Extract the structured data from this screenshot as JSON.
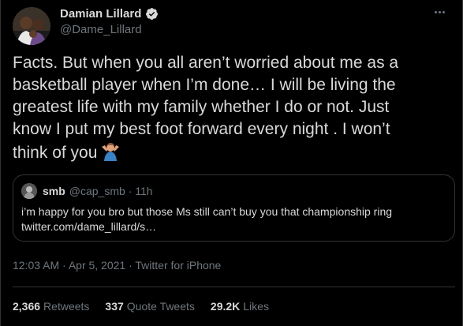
{
  "tweet": {
    "author": {
      "name": "Damian Lillard",
      "handle": "@Dame_Lillard",
      "verified_icon": "verified-badge-icon"
    },
    "more_icon": "ellipsis-icon",
    "text_lines": [
      "Facts. But when you all aren’t worried about me as a",
      "basketball player when I’m done… I will be living the",
      "greatest life with my family whether I do or not. Just",
      "know I put my best foot forward every night . I won’t",
      "think of you"
    ],
    "emoji": "person-shrugging-emoji"
  },
  "quote": {
    "name": "smb",
    "meta": "@cap_smb · 11h",
    "text_lines": [
      "i’m happy for you bro but those Ms still can’t buy you that championship ring",
      "twitter.com/dame_lillard/s…"
    ]
  },
  "timestamp": "12:03 AM · Apr 5, 2021 · Twitter for iPhone",
  "stats": {
    "retweets_count": "2,366",
    "retweets_label": "Retweets",
    "quotes_count": "337",
    "quotes_label": "Quote Tweets",
    "likes_count": "29.2K",
    "likes_label": "Likes"
  },
  "colors": {
    "background": "#000000",
    "text": "#d9d9d9",
    "muted": "#6e767d",
    "border": "#2f3336",
    "verified": "#d9d9d9"
  }
}
